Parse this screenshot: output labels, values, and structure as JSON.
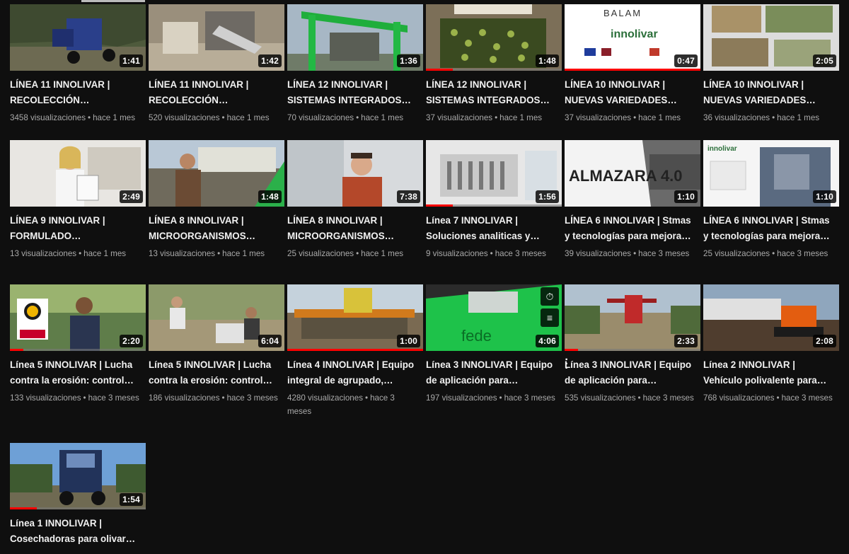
{
  "videos": [
    {
      "title": "LÍNEA 11 INNOLIVAR | RECOLECCIÓN INTEGRAL…",
      "duration": "1:41",
      "views": "3458 visualizaciones",
      "age": "hace 1 mes",
      "progress": 0,
      "art": "harvester-blue"
    },
    {
      "title": "LÍNEA 11 INNOLIVAR | RECOLECCIÓN INTEGRAL…",
      "duration": "1:42",
      "views": "520 visualizaciones",
      "age": "hace 1 mes",
      "progress": 0,
      "art": "machine-grey"
    },
    {
      "title": "LÍNEA 12 INNOLIVAR | SISTEMAS INTEGRADOS…",
      "duration": "1:36",
      "views": "70 visualizaciones",
      "age": "hace 1 mes",
      "progress": 0,
      "art": "green-frame"
    },
    {
      "title": "LÍNEA 12 INNOLIVAR | SISTEMAS INTEGRADOS…",
      "duration": "1:48",
      "views": "37 visualizaciones",
      "age": "hace 1 mes",
      "progress": 0.2,
      "art": "olives"
    },
    {
      "title": "LÍNEA 10 INNOLIVAR | NUEVAS VARIEDADES DE…",
      "duration": "0:47",
      "views": "37 visualizaciones",
      "age": "hace 1 mes",
      "progress": 1.0,
      "art": "logo-white"
    },
    {
      "title": "LÍNEA 10 INNOLIVAR | NUEVAS VARIEDADES DE…",
      "duration": "2:05",
      "views": "36 visualizaciones",
      "age": "hace 1 mes",
      "progress": 0,
      "art": "aerial"
    },
    {
      "title": "LÍNEA 9 INNOLIVAR | FORMULADO…",
      "duration": "2:49",
      "views": "13 visualizaciones",
      "age": "hace 1 mes",
      "progress": 0,
      "art": "lab-woman"
    },
    {
      "title": "LÍNEA 8 INNOLIVAR | MICROORGANISMOS…",
      "duration": "1:48",
      "views": "13 visualizaciones",
      "age": "hace 1 mes",
      "progress": 0,
      "art": "man-outdoor"
    },
    {
      "title": "LÍNEA 8 INNOLIVAR | MICROORGANISMOS…",
      "duration": "7:38",
      "views": "25 visualizaciones",
      "age": "hace 1 mes",
      "progress": 0,
      "art": "man-lab"
    },
    {
      "title": "Línea 7 INNOLIVAR | Soluciones analiticas y…",
      "duration": "1:56",
      "views": "9 visualizaciones",
      "age": "hace 3 meses",
      "progress": 0.2,
      "art": "lab-equipment"
    },
    {
      "title": "LÍNEA 6 INNOLIVAR | Stmas y tecnologías para mejora…",
      "duration": "1:10",
      "views": "39 visualizaciones",
      "age": "hace 3 meses",
      "progress": 0,
      "art": "almazara",
      "overlay_text": "ALMAZARA 4.0"
    },
    {
      "title": "LÍNEA 6 INNOLIVAR | Stmas y tecnologías para mejora…",
      "duration": "1:10",
      "views": "25 visualizaciones",
      "age": "hace 3 meses",
      "progress": 0,
      "art": "mill-machine"
    },
    {
      "title": "Línea 5 INNOLIVAR | Lucha contra la erosión: control y…",
      "duration": "2:20",
      "views": "133 visualizaciones",
      "age": "hace 3 meses",
      "progress": 0.1,
      "art": "man-field"
    },
    {
      "title": "Línea 5 INNOLIVAR | Lucha contra la erosión: control y…",
      "duration": "6:04",
      "views": "186 visualizaciones",
      "age": "hace 3 meses",
      "progress": 0,
      "art": "field-workers"
    },
    {
      "title": "Línea 4 INNOLIVAR | Equipo integral de agrupado,…",
      "duration": "1:00",
      "views": "4280 visualizaciones",
      "age": "hace 3 meses",
      "progress": 1.0,
      "art": "tractor-orange"
    },
    {
      "title": "Línea 3 INNOLIVAR | Equipo de aplicación para…",
      "duration": "4:06",
      "views": "197 visualizaciones",
      "age": "hace 3 meses",
      "progress": 0,
      "art": "green-sprayer",
      "hovered": true
    },
    {
      "title": "Línea 3 INNOLIVAR | Equipo de aplicación para…",
      "duration": "2:33",
      "views": "535 visualizaciones",
      "age": "hace 3 meses",
      "progress": 0.1,
      "art": "red-sprayer"
    },
    {
      "title": "Línea 2 INNOLIVAR | Vehículo polivalente para…",
      "duration": "2:08",
      "views": "768 visualizaciones",
      "age": "hace 3 meses",
      "progress": 0,
      "art": "orange-vehicle"
    },
    {
      "title": "Línea 1 INNOLIVAR | Cosechadoras para olivar…",
      "duration": "1:54",
      "views": "",
      "age": "",
      "progress": 0.2,
      "art": "harvester-sky"
    }
  ],
  "colors": {
    "background": "#0f0f0f",
    "progress": "#ff0000",
    "meta": "#aaaaaa"
  },
  "icons": {
    "watch_later": "clock-icon",
    "add_to_queue": "queue-icon",
    "menu": "more-vert-icon"
  }
}
